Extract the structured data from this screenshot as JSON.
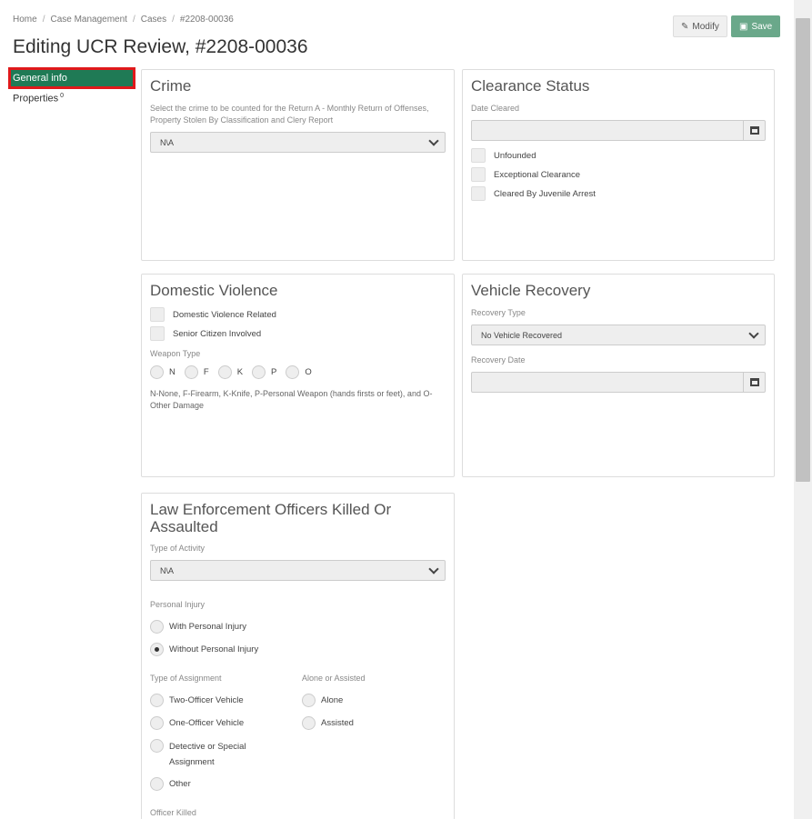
{
  "breadcrumb": [
    "Home",
    "Case Management",
    "Cases",
    "#2208-00036"
  ],
  "page_title": "Editing UCR Review, #2208-00036",
  "toolbar": {
    "modify_label": "Modify",
    "save_label": "Save"
  },
  "sidenav": {
    "general": "General info",
    "properties": "Properties",
    "properties_count": "0"
  },
  "crime": {
    "title": "Crime",
    "help": "Select the crime to be counted for the Return A - Monthly Return of Offenses, Property Stolen By Classification and Clery Report",
    "value": "N\\A"
  },
  "clearance": {
    "title": "Clearance Status",
    "date_label": "Date Cleared",
    "unfounded": "Unfounded",
    "exceptional": "Exceptional Clearance",
    "juvenile": "Cleared By Juvenile Arrest"
  },
  "domestic": {
    "title": "Domestic Violence",
    "related": "Domestic Violence Related",
    "senior": "Senior Citizen Involved",
    "weapon_label": "Weapon Type",
    "weapons": [
      "N",
      "F",
      "K",
      "P",
      "O"
    ],
    "note": "N-None, F-Firearm, K-Knife, P-Personal Weapon (hands firsts or feet), and O-Other Damage"
  },
  "vehicle": {
    "title": "Vehicle Recovery",
    "type_label": "Recovery Type",
    "type_value": "No Vehicle Recovered",
    "date_label": "Recovery Date"
  },
  "leoka": {
    "title": "Law Enforcement Officers Killed Or Assaulted",
    "activity_label": "Type of Activity",
    "activity_value": "N\\A",
    "injury_label": "Personal Injury",
    "with_injury": "With Personal Injury",
    "without_injury": "Without Personal Injury",
    "assignment_label": "Type of Assignment",
    "assignments": [
      "Two-Officer Vehicle",
      "One-Officer Vehicle",
      "Detective or Special Assignment",
      "Other"
    ],
    "alone_label": "Alone or Assisted",
    "alone": "Alone",
    "assisted": "Assisted",
    "killed_label": "Officer Killed"
  }
}
